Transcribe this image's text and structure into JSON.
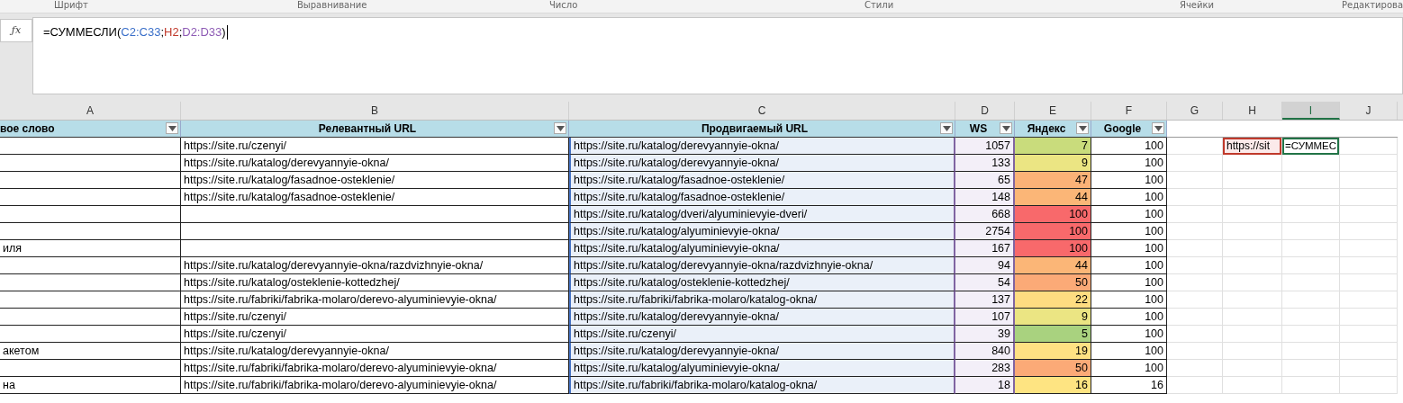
{
  "ribbon_groups": [
    "Шрифт",
    "Выравнивание",
    "Число",
    "Стили",
    "Ячейки",
    "Редактирова"
  ],
  "formula_bar": {
    "fx_label": "ƒx",
    "parts": [
      {
        "text": "=СУММЕСЛИ("
      },
      {
        "text": "C2:C33",
        "color": "#3a6fc9"
      },
      {
        "text": ";"
      },
      {
        "text": "H2",
        "color": "#c0392b"
      },
      {
        "text": ";"
      },
      {
        "text": "D2:D33",
        "color": "#8e5bb5"
      },
      {
        "text": ")"
      }
    ]
  },
  "column_headers": [
    {
      "label": "A",
      "selected": false
    },
    {
      "label": "B",
      "selected": false
    },
    {
      "label": "C",
      "selected": false
    },
    {
      "label": "D",
      "selected": false
    },
    {
      "label": "E",
      "selected": false
    },
    {
      "label": "F",
      "selected": false
    },
    {
      "label": "G",
      "selected": false
    },
    {
      "label": "H",
      "selected": false
    },
    {
      "label": "I",
      "selected": true
    },
    {
      "label": "J",
      "selected": false
    }
  ],
  "table": {
    "headers": [
      "вое слово",
      "Релевантный URL",
      "Продвигаемый URL",
      "WS",
      "Яндекс",
      "Google"
    ],
    "rows": [
      {
        "cells": [
          "",
          "https://site.ru/czenyi/",
          "https://site.ru/katalog/derevyannyie-okna/",
          "1057",
          "7",
          "100"
        ],
        "color": "#c9dc7c"
      },
      {
        "cells": [
          "",
          "https://site.ru/katalog/derevyannyie-okna/",
          "https://site.ru/katalog/derevyannyie-okna/",
          "133",
          "9",
          "100"
        ],
        "color": "#ebe583"
      },
      {
        "cells": [
          "",
          "https://site.ru/katalog/fasadnoe-osteklenie/",
          "https://site.ru/katalog/fasadnoe-osteklenie/",
          "65",
          "47",
          "100"
        ],
        "color": "#fbb277"
      },
      {
        "cells": [
          "",
          "https://site.ru/katalog/fasadnoe-osteklenie/",
          "https://site.ru/katalog/fasadnoe-osteklenie/",
          "148",
          "44",
          "100"
        ],
        "color": "#fbb677"
      },
      {
        "cells": [
          "",
          "",
          "https://site.ru/katalog/dveri/alyuminievyie-dveri/",
          "668",
          "100",
          "100"
        ],
        "color": "#f8696b"
      },
      {
        "cells": [
          "",
          "",
          "https://site.ru/katalog/alyuminievyie-okna/",
          "2754",
          "100",
          "100"
        ],
        "color": "#f8696b"
      },
      {
        "cells": [
          "иля",
          "",
          "https://site.ru/katalog/alyuminievyie-okna/",
          "167",
          "100",
          "100"
        ],
        "color": "#f8696b"
      },
      {
        "cells": [
          "",
          "https://site.ru/katalog/derevyannyie-okna/razdvizhnyie-okna/",
          "https://site.ru/katalog/derevyannyie-okna/razdvizhnyie-okna/",
          "94",
          "44",
          "100"
        ],
        "color": "#fbb677"
      },
      {
        "cells": [
          "",
          "https://site.ru/katalog/osteklenie-kottedzhej/",
          "https://site.ru/katalog/osteklenie-kottedzhej/",
          "54",
          "50",
          "100"
        ],
        "color": "#fbaa77"
      },
      {
        "cells": [
          "",
          "https://site.ru/fabriki/fabrika-molaro/derevo-alyuminievyie-okna/",
          "https://site.ru/fabriki/fabrika-molaro/katalog-okna/",
          "137",
          "22",
          "100"
        ],
        "color": "#fedc81"
      },
      {
        "cells": [
          "",
          "https://site.ru/czenyi/",
          "https://site.ru/katalog/derevyannyie-okna/",
          "107",
          "9",
          "100"
        ],
        "color": "#ebe583"
      },
      {
        "cells": [
          "",
          "https://site.ru/czenyi/",
          "https://site.ru/czenyi/",
          "39",
          "5",
          "100"
        ],
        "color": "#a9d27f"
      },
      {
        "cells": [
          "акетом",
          "https://site.ru/katalog/derevyannyie-okna/",
          "https://site.ru/katalog/derevyannyie-okna/",
          "840",
          "19",
          "100"
        ],
        "color": "#ffe183"
      },
      {
        "cells": [
          "",
          "https://site.ru/fabriki/fabrika-molaro/derevo-alyuminievyie-okna/",
          "https://site.ru/katalog/alyuminievyie-okna/",
          "283",
          "50",
          "100"
        ],
        "color": "#fbaa77"
      },
      {
        "cells": [
          "на",
          "https://site.ru/fabriki/fabrika-molaro/derevo-alyuminievyie-okna/",
          "https://site.ru/fabriki/fabrika-molaro/katalog-okna/",
          "18",
          "16",
          "16"
        ],
        "color": "#fee482"
      }
    ]
  },
  "side_cells": {
    "h2": "https://sit",
    "i2": "=СУММЕС"
  }
}
